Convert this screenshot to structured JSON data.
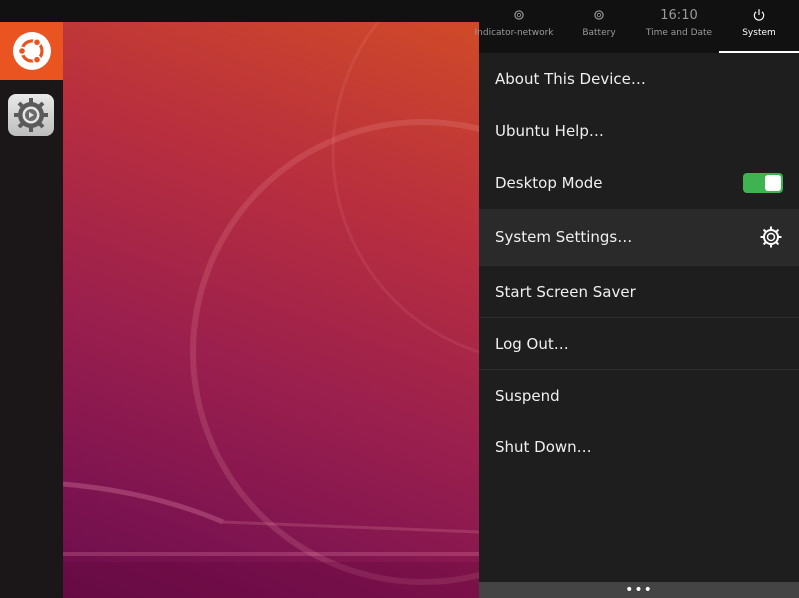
{
  "indicators": {
    "tabs": [
      {
        "label": "Indicator-network",
        "icon": "gear-icon"
      },
      {
        "label": "Battery",
        "icon": "gear-icon"
      },
      {
        "label": "Time and Date",
        "time": "16:10"
      },
      {
        "label": "System",
        "icon": "power-icon",
        "active": true
      }
    ]
  },
  "menu": {
    "items": [
      {
        "label": "About This Device…"
      },
      {
        "label": "Ubuntu Help…"
      },
      {
        "label": "Desktop Mode",
        "toggle": true
      },
      {
        "label": "System Settings…",
        "icon": "gear-icon"
      },
      {
        "label": "Start Screen Saver"
      },
      {
        "label": "Log Out…"
      },
      {
        "label": "Suspend"
      },
      {
        "label": "Shut Down…"
      }
    ]
  },
  "handle": {
    "glyph": "•••"
  },
  "launcher": {
    "items": [
      {
        "name": "ubuntu-logo-icon"
      },
      {
        "name": "system-settings-app-icon"
      }
    ]
  },
  "colors": {
    "accent": "#e95420",
    "toggle_on": "#3eb34f"
  }
}
